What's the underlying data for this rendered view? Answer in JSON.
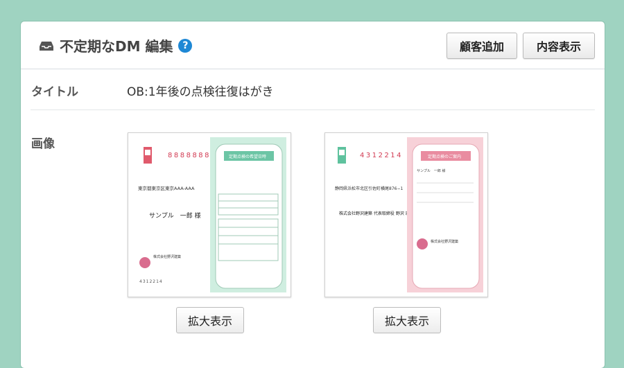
{
  "header": {
    "title": "不定期なDM 編集",
    "help": "?",
    "add_customer_button": "顧客追加",
    "show_content_button": "内容表示"
  },
  "fields": {
    "title_label": "タイトル",
    "title_value": "OB:1年後の点検往復はがき",
    "image_label": "画像"
  },
  "postcards": [
    {
      "zip": "8888888",
      "address": "東京都東京区東京AAA-AAA",
      "recipient": "サンプル　一郎 様",
      "panel_heading": "定期点検の希望日時",
      "company": "株式会社野沢建築",
      "from_zip": "4312214"
    },
    {
      "zip": "4312214",
      "address": "静岡県浜松市北区引佐町横尾876−1",
      "recipient": "株式会社野沢建築 代表取締役 野沢 理 究",
      "panel_heading": "定期点検のご案内",
      "greeting": "サンプル　一郎 様",
      "company": "株式会社野沢建築"
    }
  ],
  "zoom_button": "拡大表示",
  "colors": {
    "background": "#9fd3c1",
    "mint": "#cfeee0",
    "pink": "#f7d1d8",
    "help_icon": "#1e88d5"
  }
}
